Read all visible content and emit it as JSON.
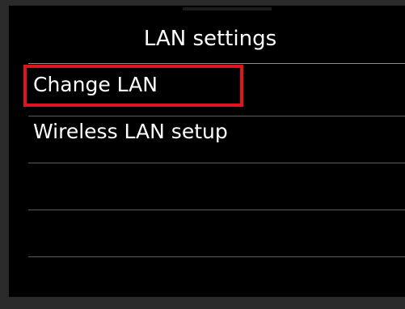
{
  "screen": {
    "title": "LAN settings"
  },
  "menu": {
    "items": [
      {
        "label": "Change LAN"
      },
      {
        "label": "Wireless LAN setup"
      },
      {
        "label": ""
      },
      {
        "label": ""
      },
      {
        "label": ""
      }
    ],
    "selected_index": 1
  },
  "colors": {
    "background": "#000000",
    "text": "#ffffff",
    "highlight": "#e0141e",
    "divider": "#5a5a5a"
  }
}
